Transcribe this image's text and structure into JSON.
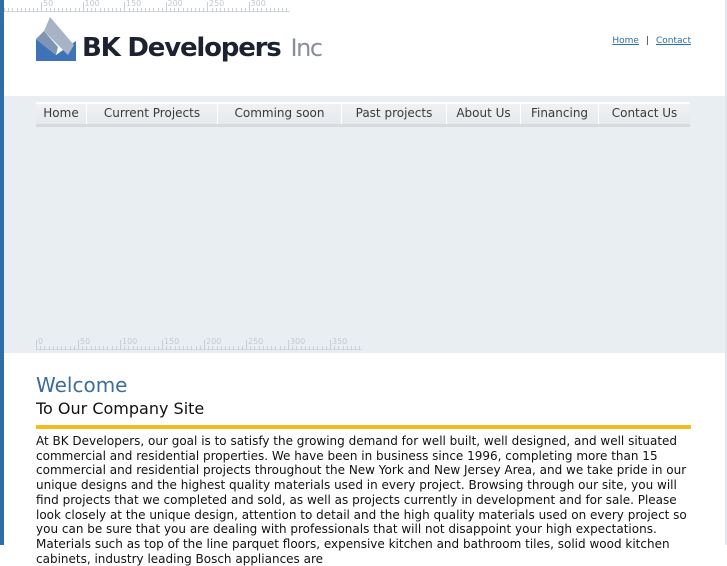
{
  "brand": {
    "name_main": "BK Developers",
    "name_suffix": "Inc",
    "colors": {
      "frame": "#2e6fa8",
      "logo_blue": "#3f73b8",
      "accent": "#f2bd1d",
      "heading": "#3d6e9a",
      "link": "#2a6fa8"
    }
  },
  "top_ruler": {
    "labels": [
      "50",
      "100",
      "150",
      "200",
      "250",
      "300"
    ]
  },
  "banner_ruler": {
    "labels": [
      "0",
      "50",
      "100",
      "150",
      "200",
      "250",
      "300",
      "350"
    ]
  },
  "toplinks": {
    "home": "Home",
    "separator": "|",
    "contact": "Contact"
  },
  "nav": {
    "items": [
      {
        "label": "Home"
      },
      {
        "label": "Current Projects"
      },
      {
        "label": "Comming soon"
      },
      {
        "label": "Past projects"
      },
      {
        "label": "About Us"
      },
      {
        "label": "Financing"
      },
      {
        "label": "Contact Us"
      }
    ]
  },
  "content": {
    "welcome": "Welcome",
    "subtitle": "To Our Company Site",
    "body": "At BK Developers, our goal is to satisfy the growing demand for well built, well designed, and well situated commercial and residential properties. We have been in business since 1996, completing more than 15 commercial and residential projects throughout the New York and New Jersey Area, and we take pride in our unique designs and the highest quality materials used in every project. Browsing through our site, you will find projects that we completed and sold, as well as projects currently in development and for sale. Please look closely at the unique design, attention to detail and the high quality materials used on every project so you can be sure that you are dealing with professionals that will not disappoint your high expectations. Materials such as top of the line parquet floors, expensive kitchen and bathroom tiles, solid wood kitchen cabinets, industry leading Bosch appliances are"
  }
}
